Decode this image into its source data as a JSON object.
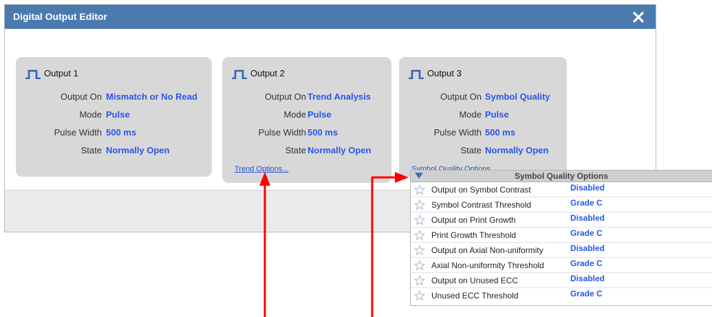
{
  "dialog": {
    "title": "Digital Output Editor",
    "close_icon": "close-icon"
  },
  "outputs": [
    {
      "title": "Output 1",
      "icon": "pulse-waveform-icon",
      "fields": [
        {
          "label": "Output On",
          "value": "Mismatch or No Read"
        },
        {
          "label": "Mode",
          "value": "Pulse"
        },
        {
          "label": "Pulse Width",
          "value": "500 ms"
        },
        {
          "label": "State",
          "value": "Normally Open"
        }
      ]
    },
    {
      "title": "Output 2",
      "icon": "pulse-waveform-icon",
      "fields": [
        {
          "label": "Output On",
          "value": "Trend Analysis"
        },
        {
          "label": "Mode",
          "value": "Pulse"
        },
        {
          "label": "Pulse Width",
          "value": "500 ms"
        },
        {
          "label": "State",
          "value": "Normally Open"
        }
      ],
      "options_link": "Trend Options..."
    },
    {
      "title": "Output 3",
      "icon": "pulse-waveform-icon",
      "fields": [
        {
          "label": "Output On",
          "value": "Symbol Quality"
        },
        {
          "label": "Mode",
          "value": "Pulse"
        },
        {
          "label": "Pulse Width",
          "value": "500 ms"
        },
        {
          "label": "State",
          "value": "Normally Open"
        }
      ],
      "options_link": "Symbol Quality Options..."
    }
  ],
  "symbol_quality_popup": {
    "title": "Symbol Quality Options",
    "rows": [
      {
        "label": "Output on Symbol Contrast",
        "value": "Disabled"
      },
      {
        "label": "Symbol Contrast Threshold",
        "value": "Grade C"
      },
      {
        "label": "Output on Print Growth",
        "value": "Disabled"
      },
      {
        "label": "Print Growth Threshold",
        "value": "Grade C"
      },
      {
        "label": "Output on Axial Non-uniformity",
        "value": "Disabled"
      },
      {
        "label": "Axial Non-uniformity Threshold",
        "value": "Grade C"
      },
      {
        "label": "Output on Unused ECC",
        "value": "Disabled"
      },
      {
        "label": "Unused ECC Threshold",
        "value": "Grade C"
      }
    ]
  },
  "colors": {
    "titlebar": "#4a7ab0",
    "card_background": "#d8d8d8",
    "value_text": "#2a56e8",
    "annotation_arrow": "#ff0000"
  }
}
